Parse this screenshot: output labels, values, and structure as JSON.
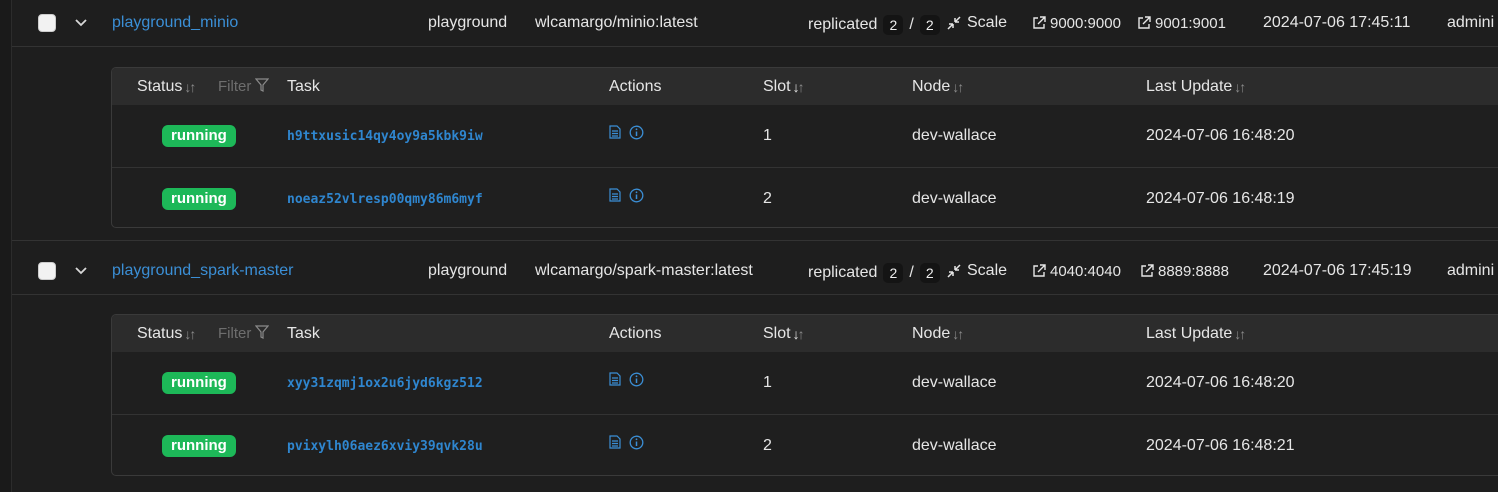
{
  "services": [
    {
      "name": "playground_minio",
      "stack": "playground",
      "image": "wlcamargo/minio:latest",
      "mode": "replicated",
      "replicas_running": "2",
      "replicas_sep": "/",
      "replicas_total": "2",
      "scale_label": "Scale",
      "ports": [
        "9000:9000",
        "9001:9001"
      ],
      "updated": "2024-07-06 17:45:11",
      "owner": "admini",
      "tasks": [
        {
          "status": "running",
          "id": "h9ttxusic14qy4oy9a5kbk9iw",
          "slot": "1",
          "node": "dev-wallace",
          "last_update": "2024-07-06 16:48:20"
        },
        {
          "status": "running",
          "id": "noeaz52vlresp00qmy86m6myf",
          "slot": "2",
          "node": "dev-wallace",
          "last_update": "2024-07-06 16:48:19"
        }
      ]
    },
    {
      "name": "playground_spark-master",
      "stack": "playground",
      "image": "wlcamargo/spark-master:latest",
      "mode": "replicated",
      "replicas_running": "2",
      "replicas_sep": "/",
      "replicas_total": "2",
      "scale_label": "Scale",
      "ports": [
        "4040:4040",
        "8889:8888"
      ],
      "updated": "2024-07-06 17:45:19",
      "owner": "admini",
      "tasks": [
        {
          "status": "running",
          "id": "xyy31zqmj1ox2u6jyd6kgz512",
          "slot": "1",
          "node": "dev-wallace",
          "last_update": "2024-07-06 16:48:20"
        },
        {
          "status": "running",
          "id": "pvixylh06aez6xviy39qvk28u",
          "slot": "2",
          "node": "dev-wallace",
          "last_update": "2024-07-06 16:48:21"
        }
      ]
    }
  ],
  "task_table": {
    "col_status": "Status",
    "filter_label": "Filter",
    "col_task": "Task",
    "col_actions": "Actions",
    "col_slot": "Slot",
    "col_node": "Node",
    "col_last_update": "Last Update"
  },
  "icons": {
    "chevron": "chevron-down-icon",
    "sort": "sort-icon",
    "filter": "filter-icon",
    "scale": "scale-icon",
    "port_link": "external-link-icon",
    "logs": "logs-icon",
    "info": "info-icon"
  },
  "colors": {
    "accent_link": "#3b8fd6",
    "running": "#1db858",
    "background": "#1e1e1e",
    "header": "#2c2c2c"
  }
}
